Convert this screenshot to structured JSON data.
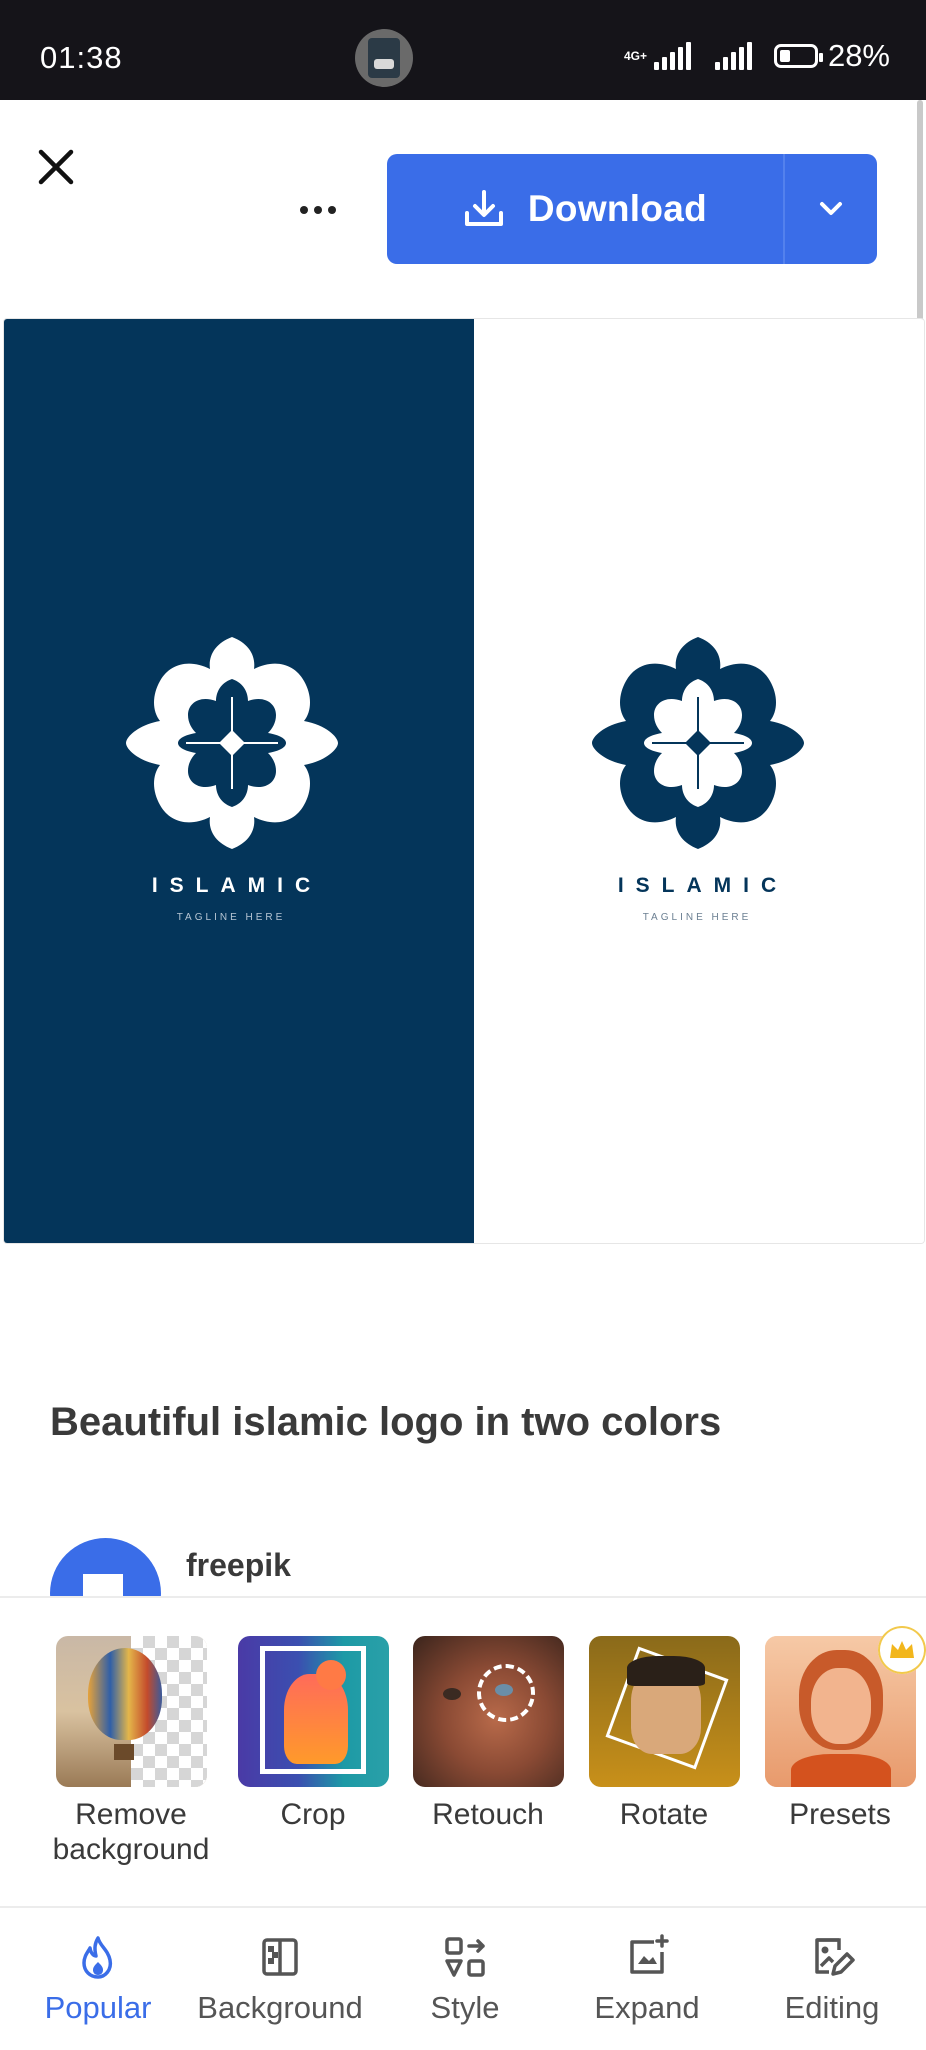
{
  "status_bar": {
    "time": "01:38",
    "network": "4G+",
    "battery_percent": "28%",
    "battery_level": 0.28
  },
  "header": {
    "close_icon": "close-icon",
    "more_icon": "more-horizontal-icon",
    "download_label": "Download",
    "download_icon": "download-icon",
    "dropdown_icon": "chevron-down-icon",
    "accent_color": "#3a6de8"
  },
  "preview": {
    "dark_bg": "#04355a",
    "light_bg": "#ffffff",
    "logo_text": "ISLAMIC",
    "logo_tagline": "TAGLINE HERE"
  },
  "title": "Beautiful islamic logo in two colors",
  "author": {
    "name": "freepik"
  },
  "tools": [
    {
      "label": "Remove background",
      "icon": "remove-background-thumb"
    },
    {
      "label": "Crop",
      "icon": "crop-thumb"
    },
    {
      "label": "Retouch",
      "icon": "retouch-thumb"
    },
    {
      "label": "Rotate",
      "icon": "rotate-thumb"
    },
    {
      "label": "Presets",
      "icon": "presets-thumb",
      "premium": true
    }
  ],
  "bottom_nav": [
    {
      "label": "Popular",
      "icon": "flame-icon",
      "active": true
    },
    {
      "label": "Background",
      "icon": "background-icon"
    },
    {
      "label": "Style",
      "icon": "style-icon"
    },
    {
      "label": "Expand",
      "icon": "expand-icon"
    },
    {
      "label": "Editing",
      "icon": "editing-icon"
    }
  ]
}
